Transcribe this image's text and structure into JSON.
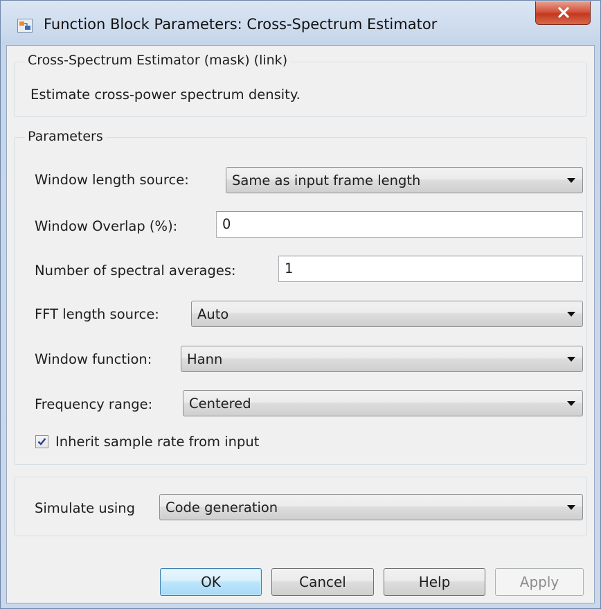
{
  "window": {
    "title": "Function Block Parameters: Cross-Spectrum Estimator"
  },
  "mask_group": {
    "legend": "Cross-Spectrum Estimator (mask) (link)",
    "description": "Estimate cross-power spectrum density."
  },
  "parameters": {
    "legend": "Parameters",
    "window_length_source": {
      "label": "Window length source:",
      "value": "Same as input frame length"
    },
    "window_overlap": {
      "label": "Window Overlap (%):",
      "value": "0"
    },
    "spectral_averages": {
      "label": "Number of spectral averages:",
      "value": "1"
    },
    "fft_length_source": {
      "label": "FFT length source:",
      "value": "Auto"
    },
    "window_function": {
      "label": "Window function:",
      "value": "Hann"
    },
    "frequency_range": {
      "label": "Frequency range:",
      "value": "Centered"
    },
    "inherit_sample_rate": {
      "label": "Inherit sample rate from input",
      "checked": true
    }
  },
  "simulate": {
    "label": "Simulate using",
    "value": "Code generation"
  },
  "buttons": {
    "ok": "OK",
    "cancel": "Cancel",
    "help": "Help",
    "apply": "Apply"
  },
  "icons": {
    "app": "simulink-block-icon",
    "close": "close-icon",
    "dropdown": "chevron-down-icon",
    "check": "checkmark-icon"
  },
  "colors": {
    "close_button": "#c3381f",
    "default_button_border": "#3c7fb1",
    "dialog_background": "#f0f0f0"
  }
}
